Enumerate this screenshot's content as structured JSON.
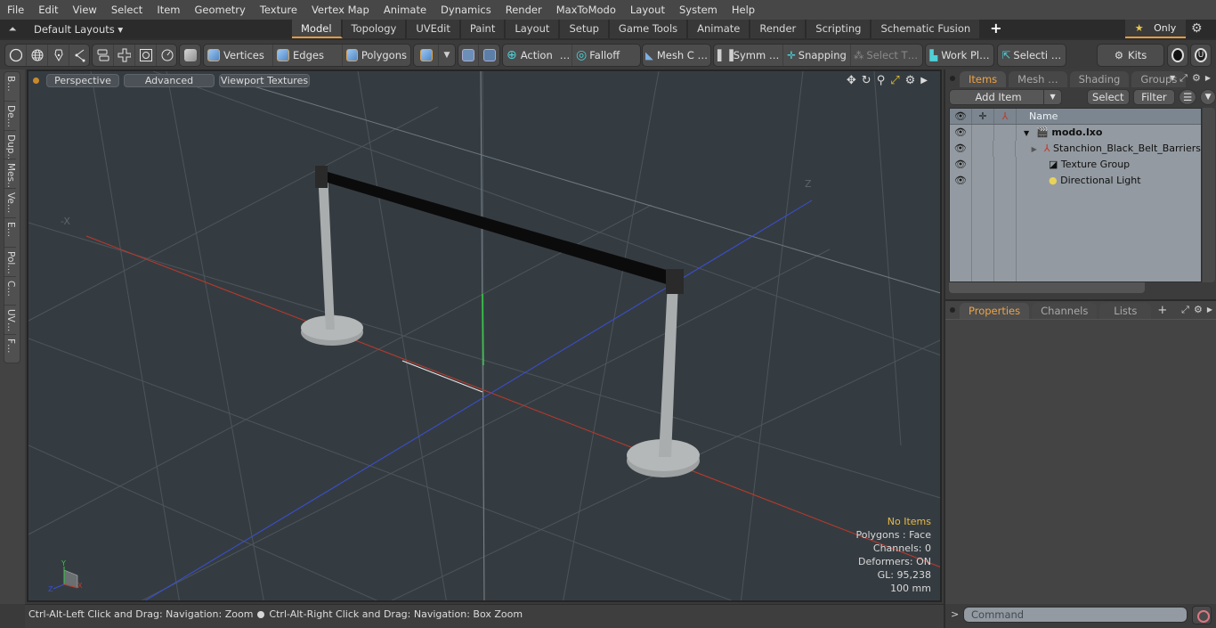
{
  "menu": [
    "File",
    "Edit",
    "View",
    "Select",
    "Item",
    "Geometry",
    "Texture",
    "Vertex Map",
    "Animate",
    "Dynamics",
    "Render",
    "MaxToModo",
    "Layout",
    "System",
    "Help"
  ],
  "layouts": {
    "selector": "Default Layouts ▾",
    "tabs": [
      "Model",
      "Topology",
      "UVEdit",
      "Paint",
      "Layout",
      "Setup",
      "Game Tools",
      "Animate",
      "Render",
      "Scripting",
      "Schematic Fusion"
    ],
    "active_tab": "Model",
    "add_tab": "+",
    "only_label": "Only",
    "only_icon": "★"
  },
  "toolbar": {
    "vertices": "Vertices",
    "edges": "Edges",
    "polygons": "Polygons",
    "action": "Action",
    "falloff": "Falloff",
    "mesh_constraints": "Mesh C …",
    "symmetry": "Symm …",
    "snapping": "Snapping",
    "select_through": "Select T…",
    "work_plane": "Work Pl…",
    "selection_sets": "Selecti …",
    "kits": "Kits",
    "ellipsis": "…"
  },
  "left_strip": [
    "B…",
    "De…",
    "Dup…",
    "Mes…",
    "Ve…",
    "E…",
    "Pol…",
    "C…",
    "UV…",
    "F…"
  ],
  "viewport": {
    "view_mode": "Perspective",
    "shading": "Advanced",
    "textures": "Viewport Textures",
    "stats": {
      "selection": "No Items",
      "polygons": "Polygons : Face",
      "channels": "Channels: 0",
      "deformers": "Deformers: ON",
      "gl": "GL: 95,238",
      "scale": "100 mm"
    },
    "axis_labels": {
      "x": "X",
      "y": "Y",
      "z": "Z",
      "neg_x": "-X",
      "pos_z": "Z"
    },
    "colors": {
      "x_axis": "#c0392b",
      "y_axis": "#2ecc40",
      "z_axis": "#3a4fd8",
      "belt": "#0b0b0b",
      "post": "#a8abab"
    }
  },
  "status": {
    "hint1": "Ctrl-Alt-Left Click and Drag: Navigation: Zoom",
    "hint2": "Ctrl-Alt-Right Click and Drag: Navigation: Box Zoom"
  },
  "items_panel": {
    "tabs": [
      "Items",
      "Mesh …",
      "Shading",
      "Groups"
    ],
    "active_tab": "Items",
    "add_item": "Add Item",
    "select": "Select",
    "filter": "Filter",
    "column_name": "Name",
    "tree": [
      {
        "name": "modo.lxo",
        "icon": "scene-icon",
        "bold": true
      },
      {
        "name": "Stanchion_Black_Belt_Barriers",
        "icon": "mesh-locator-icon"
      },
      {
        "name": "Texture Group",
        "icon": "texture-group-icon"
      },
      {
        "name": "Directional Light",
        "icon": "light-icon"
      }
    ]
  },
  "properties_panel": {
    "tabs": [
      "Properties",
      "Channels",
      "Lists"
    ],
    "active_tab": "Properties",
    "add_tab": "+"
  },
  "command": {
    "prompt": ">",
    "placeholder": "Command"
  },
  "accent": "#e59a3b"
}
